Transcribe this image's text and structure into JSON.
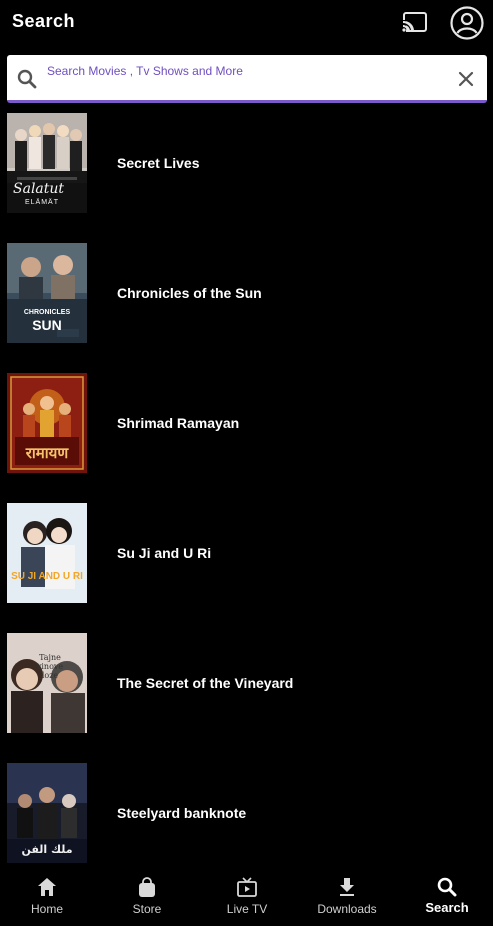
{
  "header": {
    "title": "Search"
  },
  "search": {
    "placeholder": "Search Movies , Tv Shows and More",
    "value": ""
  },
  "results": [
    {
      "title": "Secret Lives",
      "poster_text": "Salatut",
      "poster_subtext": "ELÄMÄT",
      "poster_color": "#c9c2bd"
    },
    {
      "title": "Chronicles of the Sun",
      "poster_text": "CHRONICLES",
      "poster_subtext": "SUN",
      "poster_color": "#2a3a4a"
    },
    {
      "title": "Shrimad Ramayan",
      "poster_text": "रामायण",
      "poster_subtext": "",
      "poster_color": "#8a1d12"
    },
    {
      "title": "Su Ji and U Ri",
      "poster_text": "SU JI AND U RI",
      "poster_subtext": "",
      "poster_color": "#dfe9f2"
    },
    {
      "title": "The Secret of the Vineyard",
      "poster_text": "Tajne vinove loze",
      "poster_subtext": "",
      "poster_color": "#d9cfc8"
    },
    {
      "title": "Steelyard banknote",
      "poster_text": "ملك الفن",
      "poster_subtext": "",
      "poster_color": "#1b1f2e"
    }
  ],
  "nav": [
    {
      "label": "Home",
      "icon": "home-icon"
    },
    {
      "label": "Store",
      "icon": "bag-icon"
    },
    {
      "label": "Live TV",
      "icon": "tv-icon"
    },
    {
      "label": "Downloads",
      "icon": "download-icon"
    },
    {
      "label": "Search",
      "icon": "search-icon",
      "active": true
    }
  ],
  "colors": {
    "accent": "#7b59c9",
    "background": "#000000"
  }
}
